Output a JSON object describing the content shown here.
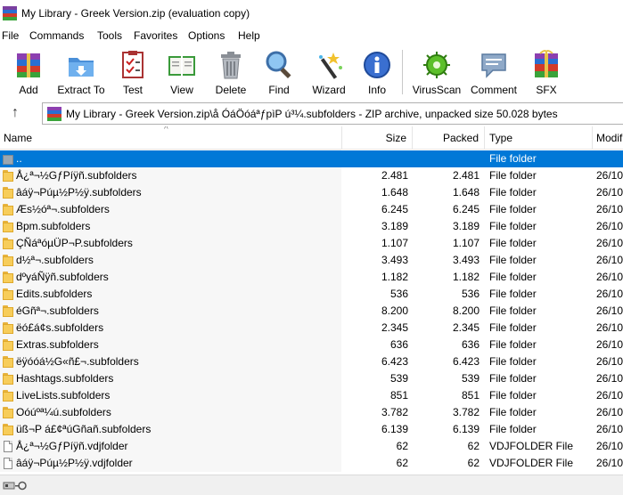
{
  "window": {
    "title": "My Library - Greek Version.zip (evaluation copy)"
  },
  "menu": [
    "File",
    "Commands",
    "Tools",
    "Favorites",
    "Options",
    "Help"
  ],
  "toolbar": {
    "buttons": [
      {
        "id": "add",
        "label": "Add",
        "icon": "winrar-books-icon"
      },
      {
        "id": "extract",
        "label": "Extract To",
        "icon": "folder-extract-icon"
      },
      {
        "id": "test",
        "label": "Test",
        "icon": "checklist-icon"
      },
      {
        "id": "view",
        "label": "View",
        "icon": "open-book-icon"
      },
      {
        "id": "delete",
        "label": "Delete",
        "icon": "trash-can-icon"
      },
      {
        "id": "find",
        "label": "Find",
        "icon": "magnifier-icon"
      },
      {
        "id": "wizard",
        "label": "Wizard",
        "icon": "magic-wand-icon"
      },
      {
        "id": "info",
        "label": "Info",
        "icon": "info-icon"
      },
      {
        "id": "virusscan",
        "label": "VirusScan",
        "icon": "virus-icon"
      },
      {
        "id": "comment",
        "label": "Comment",
        "icon": "speech-bubble-icon"
      },
      {
        "id": "sfx",
        "label": "SFX",
        "icon": "gift-box-icon"
      }
    ]
  },
  "path": {
    "text": "My Library - Greek Version.zip\\å ÓáÖóáªƒpìP ú³¼.subfolders - ZIP archive, unpacked size 50.028 bytes"
  },
  "columns": {
    "name": "Name",
    "size": "Size",
    "packed": "Packed",
    "type": "Type",
    "modified": "Modifi"
  },
  "rows": [
    {
      "kind": "up",
      "name": "..",
      "size": "",
      "packed": "",
      "type": "File folder",
      "modified": ""
    },
    {
      "kind": "folder",
      "name": "Å¿ª¬½GƒPíÿñ.subfolders",
      "size": "2.481",
      "packed": "2.481",
      "type": "File folder",
      "modified": "26/10"
    },
    {
      "kind": "folder",
      "name": "âáÿ¬Púµ½P½ÿ.subfolders",
      "size": "1.648",
      "packed": "1.648",
      "type": "File folder",
      "modified": "26/10"
    },
    {
      "kind": "folder",
      "name": "Æs½óª¬.subfolders",
      "size": "6.245",
      "packed": "6.245",
      "type": "File folder",
      "modified": "26/10"
    },
    {
      "kind": "folder",
      "name": "Bpm.subfolders",
      "size": "3.189",
      "packed": "3.189",
      "type": "File folder",
      "modified": "26/10"
    },
    {
      "kind": "folder",
      "name": "ÇÑáªóµÜP¬P.subfolders",
      "size": "1.107",
      "packed": "1.107",
      "type": "File folder",
      "modified": "26/10"
    },
    {
      "kind": "folder",
      "name": "d½ª¬.subfolders",
      "size": "3.493",
      "packed": "3.493",
      "type": "File folder",
      "modified": "26/10"
    },
    {
      "kind": "folder",
      "name": "dºyáÑÿñ.subfolders",
      "size": "1.182",
      "packed": "1.182",
      "type": "File folder",
      "modified": "26/10"
    },
    {
      "kind": "folder",
      "name": "Edits.subfolders",
      "size": "536",
      "packed": "536",
      "type": "File folder",
      "modified": "26/10"
    },
    {
      "kind": "folder",
      "name": "éGñª¬.subfolders",
      "size": "8.200",
      "packed": "8.200",
      "type": "File folder",
      "modified": "26/10"
    },
    {
      "kind": "folder",
      "name": "ëó£á¢s.subfolders",
      "size": "2.345",
      "packed": "2.345",
      "type": "File folder",
      "modified": "26/10"
    },
    {
      "kind": "folder",
      "name": "Extras.subfolders",
      "size": "636",
      "packed": "636",
      "type": "File folder",
      "modified": "26/10"
    },
    {
      "kind": "folder",
      "name": "ëÿóóá½G«ñ£¬.subfolders",
      "size": "6.423",
      "packed": "6.423",
      "type": "File folder",
      "modified": "26/10"
    },
    {
      "kind": "folder",
      "name": "Hashtags.subfolders",
      "size": "539",
      "packed": "539",
      "type": "File folder",
      "modified": "26/10"
    },
    {
      "kind": "folder",
      "name": "LiveLists.subfolders",
      "size": "851",
      "packed": "851",
      "type": "File folder",
      "modified": "26/10"
    },
    {
      "kind": "folder",
      "name": "Oóúºª¼ú.subfolders",
      "size": "3.782",
      "packed": "3.782",
      "type": "File folder",
      "modified": "26/10"
    },
    {
      "kind": "folder",
      "name": "üß¬P á£¢ªúGñañ.subfolders",
      "size": "6.139",
      "packed": "6.139",
      "type": "File folder",
      "modified": "26/10"
    },
    {
      "kind": "file",
      "name": "Å¿ª¬½GƒPíÿñ.vdjfolder",
      "size": "62",
      "packed": "62",
      "type": "VDJFOLDER File",
      "modified": "26/10"
    },
    {
      "kind": "file",
      "name": "âáÿ¬Púµ½P½ÿ.vdjfolder",
      "size": "62",
      "packed": "62",
      "type": "VDJFOLDER File",
      "modified": "26/10"
    }
  ]
}
